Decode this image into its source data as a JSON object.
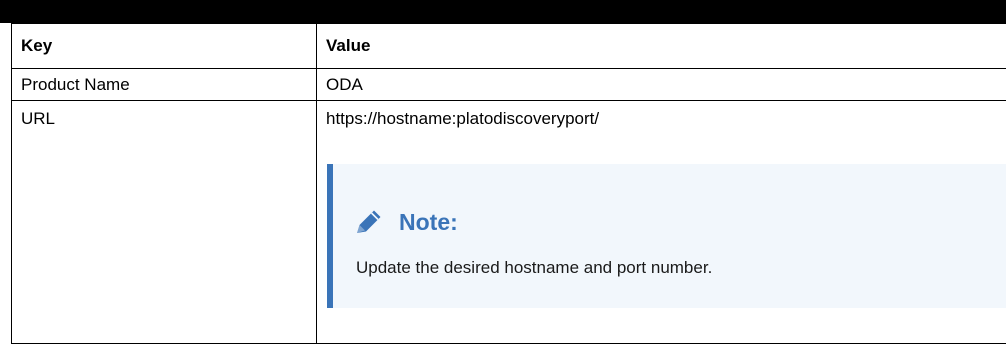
{
  "table": {
    "headers": {
      "key": "Key",
      "value": "Value"
    },
    "rows": [
      {
        "key": "Product Name",
        "value": "ODA"
      },
      {
        "key": "URL",
        "value": "https://hostname:platodiscoveryport/"
      }
    ]
  },
  "note": {
    "title": "Note:",
    "text": "Update the desired hostname and port number.",
    "icon": "pencil-icon",
    "accent_color": "#3a74b8",
    "background_color": "#f2f7fc"
  }
}
